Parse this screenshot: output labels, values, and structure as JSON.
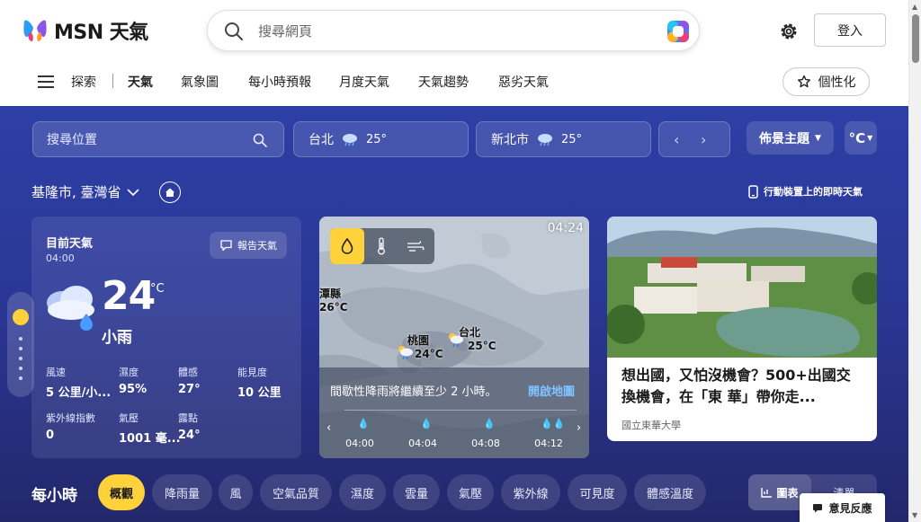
{
  "header": {
    "logo_text": "MSN 天氣",
    "search_placeholder": "搜尋網頁",
    "login_label": "登入"
  },
  "nav": {
    "items": [
      "探索",
      "天氣",
      "氣象圖",
      "每小時預報",
      "月度天氣",
      "天氣趨勢",
      "惡劣天氣"
    ],
    "personalize_label": "個性化"
  },
  "weather_toolbar": {
    "search_placeholder": "搜尋位置",
    "locations": [
      {
        "name": "台北",
        "temp": "25°"
      },
      {
        "name": "新北市",
        "temp": "25°"
      }
    ],
    "theme_label": "佈景主題",
    "unit_label": "°C"
  },
  "location": {
    "name": "基隆市, 臺灣省",
    "mobile_link": "行動裝置上的即時天氣"
  },
  "current": {
    "title": "目前天氣",
    "time": "04:00",
    "report_label": "報告天氣",
    "temp": "24",
    "unit": "°C",
    "condition": "小雨",
    "stats": [
      {
        "label": "風速",
        "value": "5 公里/小..."
      },
      {
        "label": "濕度",
        "value": "95%"
      },
      {
        "label": "體感",
        "value": "27°"
      },
      {
        "label": "能見度",
        "value": "10 公里"
      },
      {
        "label": "紫外線指數",
        "value": "0"
      },
      {
        "label": "氣壓",
        "value": "1001 毫..."
      },
      {
        "label": "露點",
        "value": "24°"
      }
    ]
  },
  "map": {
    "time": "04:24",
    "labels": [
      {
        "name": "潭縣",
        "temp": "26°C"
      },
      {
        "name": "桃園",
        "temp": "24°C"
      },
      {
        "name": "台北",
        "temp": "25°C"
      }
    ],
    "message": "間歇性降雨將繼續至少 2 小時。",
    "open_label": "開啟地圖",
    "timeline": [
      "04:00",
      "04:04",
      "04:08",
      "04:12"
    ]
  },
  "news": {
    "title": "想出國，又怕沒機會？500+出國交換機會，在「東 華」帶你走...",
    "source": "國立東華大學"
  },
  "hourly": {
    "title": "每小時",
    "tabs": [
      "概觀",
      "降雨量",
      "風",
      "空氣品質",
      "濕度",
      "雲量",
      "氣壓",
      "紫外線",
      "可見度",
      "體感溫度"
    ],
    "view_chart": "圖表",
    "view_list": "清單"
  },
  "feedback_label": "意見反應",
  "colors": {
    "accent": "#ffd23b",
    "weather_bg": "#2d3fa6",
    "link": "#7fc3ff"
  }
}
